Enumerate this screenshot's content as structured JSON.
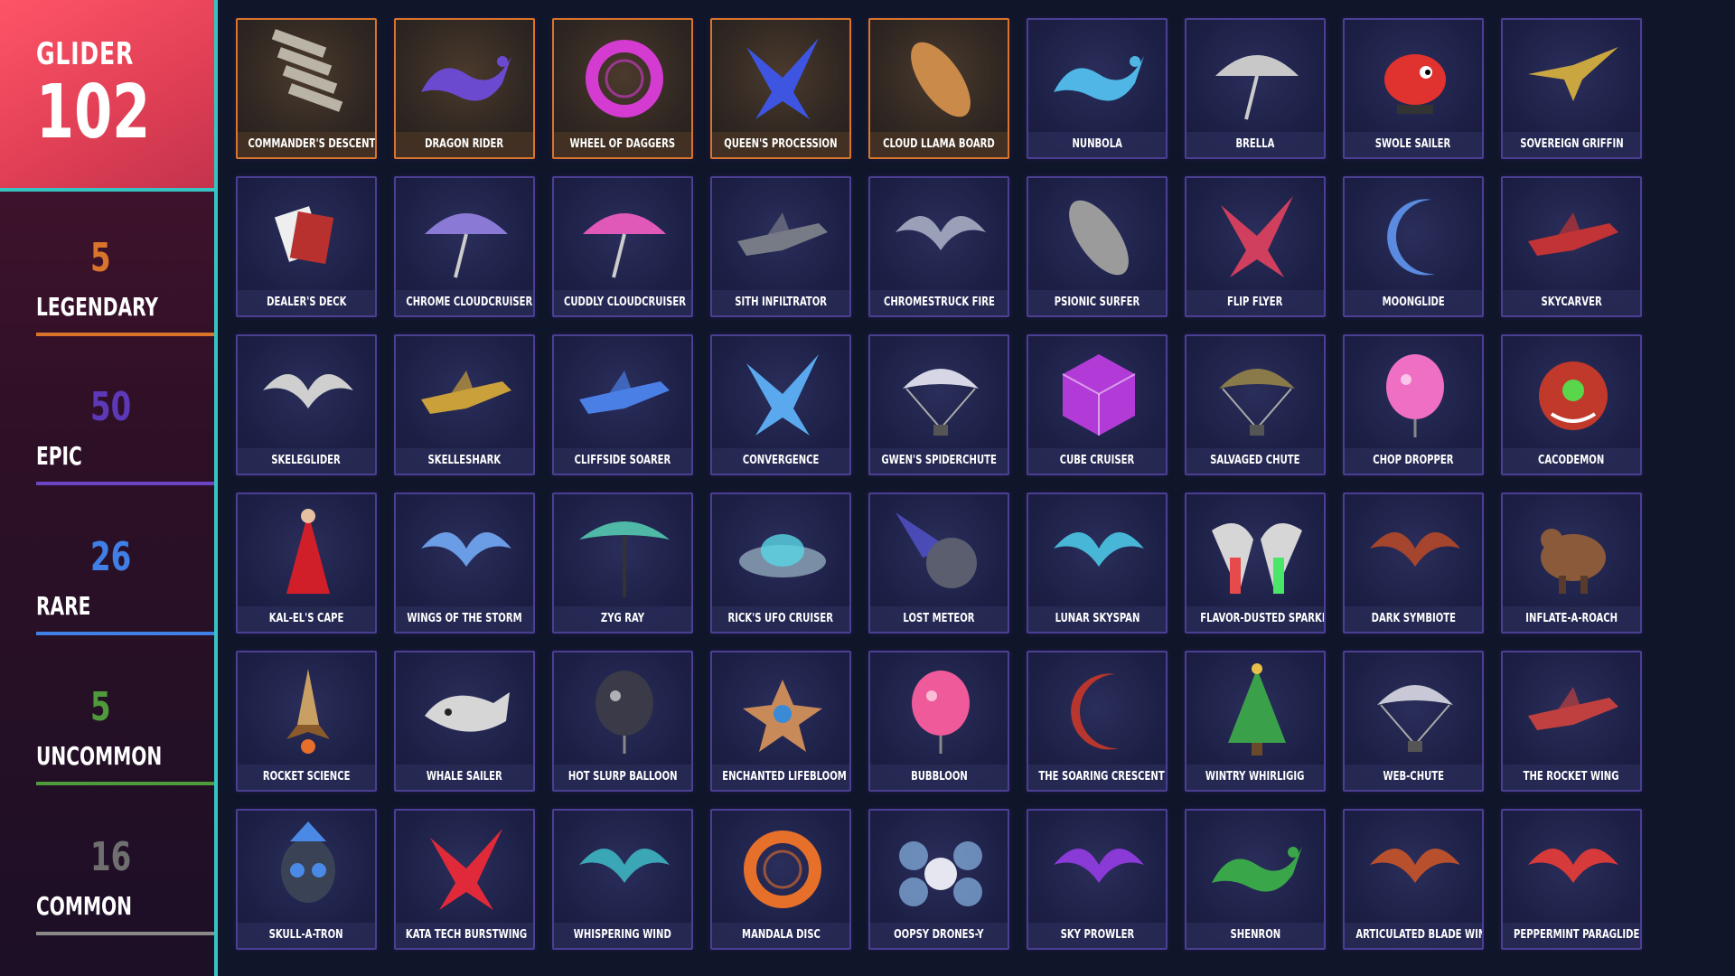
{
  "header": {
    "title": "GLIDER",
    "total": "102"
  },
  "rarities": [
    {
      "count": "5",
      "label": "LEGENDARY",
      "color": "#d9742a",
      "count_color": "#d9742a"
    },
    {
      "count": "50",
      "label": "EPIC",
      "color": "#6b45c4",
      "count_color": "#5d39b9"
    },
    {
      "count": "26",
      "label": "RARE",
      "color": "#3f7fe6",
      "count_color": "#3f7fe6"
    },
    {
      "count": "5",
      "label": "UNCOMMON",
      "color": "#4f9a3a",
      "count_color": "#4f9a3a"
    },
    {
      "count": "16",
      "label": "COMMON",
      "color": "#8a8a8a",
      "count_color": "#6f6f6f"
    }
  ],
  "gliders": [
    {
      "name": "COMMANDER'S DESCENT",
      "rarity": "legendary",
      "icon": "stacked-wings-icon",
      "color": "#b9b4a6"
    },
    {
      "name": "DRAGON RIDER",
      "rarity": "legendary",
      "icon": "dragon-icon",
      "color": "#6b4ad0"
    },
    {
      "name": "WHEEL OF DAGGERS",
      "rarity": "legendary",
      "icon": "ring-icon",
      "color": "#d43bd0"
    },
    {
      "name": "QUEEN'S PROCESSION",
      "rarity": "legendary",
      "icon": "crystal-wing-icon",
      "color": "#3d55e0"
    },
    {
      "name": "CLOUD LLAMA BOARD",
      "rarity": "legendary",
      "icon": "board-icon",
      "color": "#c98a4a"
    },
    {
      "name": "NUNBOLA",
      "rarity": "epic",
      "icon": "dragon-icon",
      "color": "#4fb6e6"
    },
    {
      "name": "BRELLA",
      "rarity": "epic",
      "icon": "umbrella-icon",
      "color": "#c8c8c8"
    },
    {
      "name": "SWOLE SAILER",
      "rarity": "epic",
      "icon": "fish-icon",
      "color": "#e0322f"
    },
    {
      "name": "SOVEREIGN GRIFFIN",
      "rarity": "epic",
      "icon": "bird-icon",
      "color": "#c9a63f"
    },
    {
      "name": "DEALER'S DECK",
      "rarity": "epic",
      "icon": "cards-icon",
      "color": "#b8312e"
    },
    {
      "name": "CHROME CLOUDCRUISER",
      "rarity": "epic",
      "icon": "umbrella-icon",
      "color": "#8a7ad6"
    },
    {
      "name": "CUDDLY CLOUDCRUISER",
      "rarity": "epic",
      "icon": "umbrella-icon",
      "color": "#e058b8"
    },
    {
      "name": "SITH INFILTRATOR",
      "rarity": "epic",
      "icon": "ship-icon",
      "color": "#777b86"
    },
    {
      "name": "CHROMESTRUCK FIRE",
      "rarity": "epic",
      "icon": "wing-icon",
      "color": "#9aa0b8"
    },
    {
      "name": "PSIONIC SURFER",
      "rarity": "epic",
      "icon": "board-icon",
      "color": "#9b9b9b"
    },
    {
      "name": "FLIP FLYER",
      "rarity": "epic",
      "icon": "crystal-wing-icon",
      "color": "#d0405e"
    },
    {
      "name": "MOONGLIDE",
      "rarity": "epic",
      "icon": "crescent-icon",
      "color": "#5a8be0"
    },
    {
      "name": "SKYCARVER",
      "rarity": "epic",
      "icon": "ship-icon",
      "color": "#c23335"
    },
    {
      "name": "SKELEGLIDER",
      "rarity": "epic",
      "icon": "wing-icon",
      "color": "#cfcfcf"
    },
    {
      "name": "SKELLESHARK",
      "rarity": "epic",
      "icon": "ship-icon",
      "color": "#c9a03a"
    },
    {
      "name": "CLIFFSIDE SOARER",
      "rarity": "epic",
      "icon": "ship-icon",
      "color": "#4a7fe6"
    },
    {
      "name": "CONVERGENCE",
      "rarity": "epic",
      "icon": "crystal-wing-icon",
      "color": "#5aa9ee"
    },
    {
      "name": "GWEN'S SPIDERCHUTE",
      "rarity": "epic",
      "icon": "parachute-icon",
      "color": "#d6d6e6"
    },
    {
      "name": "CUBE CRUISER",
      "rarity": "epic",
      "icon": "cube-icon",
      "color": "#b23ad6"
    },
    {
      "name": "SALVAGED CHUTE",
      "rarity": "epic",
      "icon": "parachute-icon",
      "color": "#8a7a4a"
    },
    {
      "name": "CHOP DROPPER",
      "rarity": "epic",
      "icon": "balloon-icon",
      "color": "#ef6fc5"
    },
    {
      "name": "CACODEMON",
      "rarity": "epic",
      "icon": "monster-icon",
      "color": "#c0392b"
    },
    {
      "name": "KAL-EL'S CAPE",
      "rarity": "epic",
      "icon": "cape-icon",
      "color": "#d11f2a"
    },
    {
      "name": "WINGS OF THE STORM",
      "rarity": "epic",
      "icon": "wing-icon",
      "color": "#6b9ce6"
    },
    {
      "name": "ZYG RAY",
      "rarity": "epic",
      "icon": "ray-icon",
      "color": "#4fb8a6"
    },
    {
      "name": "RICK'S UFO CRUISER",
      "rarity": "epic",
      "icon": "ufo-icon",
      "color": "#7a8ea6"
    },
    {
      "name": "LOST METEOR",
      "rarity": "epic",
      "icon": "meteor-icon",
      "color": "#5a5ae0"
    },
    {
      "name": "LUNAR SKYSPAN",
      "rarity": "epic",
      "icon": "wing-icon",
      "color": "#48b6d6"
    },
    {
      "name": "FLAVOR-DUSTED SPARKLEWINGS",
      "rarity": "epic",
      "icon": "rainbow-wing-icon",
      "color": "#d6d6d6"
    },
    {
      "name": "DARK SYMBIOTE",
      "rarity": "epic",
      "icon": "wing-icon",
      "color": "#a6452e"
    },
    {
      "name": "INFLATE-A-ROACH",
      "rarity": "epic",
      "icon": "creature-icon",
      "color": "#8a5a3a"
    },
    {
      "name": "ROCKET SCIENCE",
      "rarity": "epic",
      "icon": "rocket-icon",
      "color": "#c9a063"
    },
    {
      "name": "WHALE SAILER",
      "rarity": "epic",
      "icon": "whale-icon",
      "color": "#d6d6d6"
    },
    {
      "name": "HOT SLURP BALLOON",
      "rarity": "epic",
      "icon": "balloon-icon",
      "color": "#3a3a48"
    },
    {
      "name": "ENCHANTED LIFEBLOOM",
      "rarity": "epic",
      "icon": "flower-icon",
      "color": "#c98a5a"
    },
    {
      "name": "BUBBLOON",
      "rarity": "epic",
      "icon": "balloon-icon",
      "color": "#ef5a9a"
    },
    {
      "name": "THE SOARING CRESCENT",
      "rarity": "epic",
      "icon": "crescent-icon",
      "color": "#b8362e"
    },
    {
      "name": "WINTRY WHIRLIGIG",
      "rarity": "epic",
      "icon": "tree-icon",
      "color": "#3aa04a"
    },
    {
      "name": "WEB-CHUTE",
      "rarity": "epic",
      "icon": "parachute-icon",
      "color": "#c8c8d6"
    },
    {
      "name": "THE ROCKET WING",
      "rarity": "epic",
      "icon": "ship-icon",
      "color": "#c04040"
    },
    {
      "name": "SKULL-A-TRON",
      "rarity": "epic",
      "icon": "skull-icon",
      "color": "#4a8ae6"
    },
    {
      "name": "KATA TECH BURSTWING",
      "rarity": "epic",
      "icon": "crystal-wing-icon",
      "color": "#e02a3a"
    },
    {
      "name": "WHISPERING WIND",
      "rarity": "epic",
      "icon": "wing-icon",
      "color": "#3aa6b6"
    },
    {
      "name": "MANDALA DISC",
      "rarity": "epic",
      "icon": "ring-icon",
      "color": "#e6702a"
    },
    {
      "name": "OOPSY DRONES-Y",
      "rarity": "epic",
      "icon": "drone-icon",
      "color": "#8ab6e6"
    },
    {
      "name": "SKY PROWLER",
      "rarity": "epic",
      "icon": "wing-icon",
      "color": "#8a3ad6"
    },
    {
      "name": "SHENRON",
      "rarity": "epic",
      "icon": "dragon-icon",
      "color": "#3aa64a"
    },
    {
      "name": "ARTICULATED BLADE WING",
      "rarity": "epic",
      "icon": "wing-icon",
      "color": "#b8502e"
    },
    {
      "name": "PEPPERMINT PARAGLIDER",
      "rarity": "epic",
      "icon": "wing-icon",
      "color": "#d63a3a"
    }
  ]
}
